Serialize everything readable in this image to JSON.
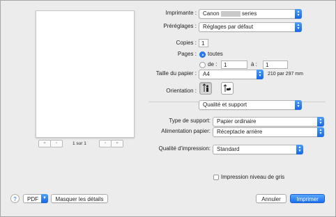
{
  "preview": {
    "first_btn": "«",
    "prev_btn": "‹",
    "next_btn": "›",
    "last_btn": "»",
    "page_label": "1 sur 1"
  },
  "printer": {
    "label": "Imprimante :",
    "value_prefix": "Canon",
    "value_suffix": "series"
  },
  "presets": {
    "label": "Préréglages :",
    "value": "Réglages par défaut"
  },
  "copies": {
    "label": "Copies :",
    "value": "1"
  },
  "pages": {
    "label": "Pages :",
    "all_label": "toutes",
    "from_label": "de :",
    "from_value": "1",
    "to_label": "à :",
    "to_value": "1"
  },
  "paper_size": {
    "label": "Taille du papier :",
    "value": "A4",
    "dimensions": "210 par 297 mm"
  },
  "orientation": {
    "label": "Orientation :"
  },
  "section": {
    "value": "Qualité et support"
  },
  "media_type": {
    "label": "Type de support:",
    "value": "Papier ordinaire"
  },
  "paper_source": {
    "label": "Alimentation papier:",
    "value": "Réceptacle arrière"
  },
  "print_quality": {
    "label": "Qualité d'impression:",
    "value": "Standard"
  },
  "grayscale": {
    "label": "Impression niveau de gris"
  },
  "footer": {
    "help": "?",
    "pdf_label": "PDF",
    "details_label": "Masquer les détails",
    "cancel_label": "Annuler",
    "print_label": "Imprimer"
  },
  "colors": {
    "accent": "#1b6ff0",
    "window_bg": "#ececec"
  }
}
